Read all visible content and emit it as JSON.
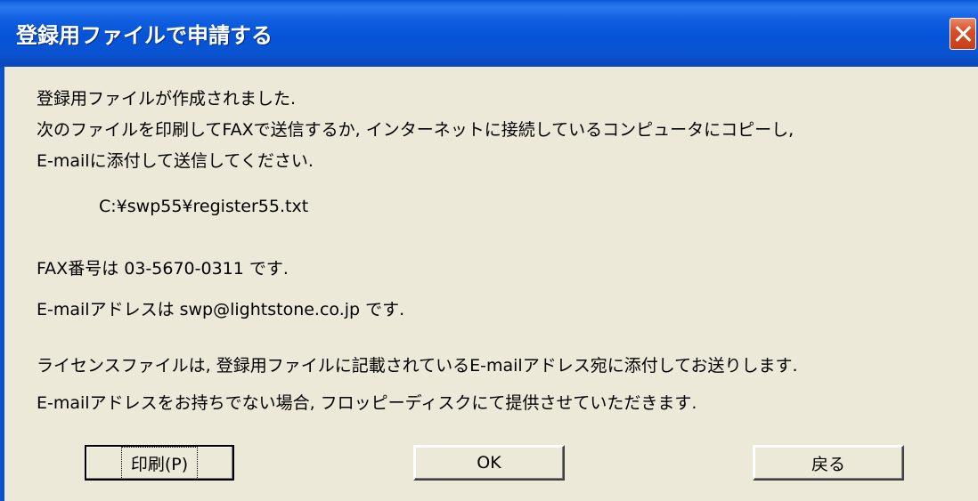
{
  "dialog": {
    "title": "登録用ファイルで申請する",
    "lines": [
      "登録用ファイルが作成されました.",
      "次のファイルを印刷してFAXで送信するか, インターネットに接続しているコンピュータにコピーし,",
      "E-mailに添付して送信してください.",
      "C:¥swp55¥register55.txt",
      "FAX番号は 03-5670-0311 です.",
      "E-mailアドレスは swp@lightstone.co.jp です.",
      "ライセンスファイルは, 登録用ファイルに記載されているE-mailアドレス宛に添付してお送りします.",
      "E-mailアドレスをお持ちでない場合, フロッピーディスクにて提供させていただきます."
    ],
    "buttons": {
      "print": "印刷(P)",
      "ok": "OK",
      "back": "戻る"
    }
  }
}
